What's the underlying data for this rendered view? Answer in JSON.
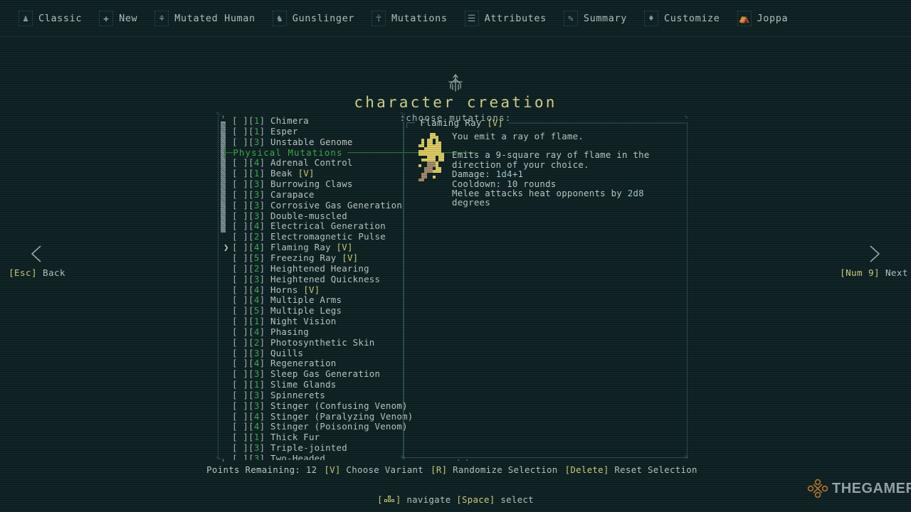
{
  "colors": {
    "background": "#0e2124",
    "title": "#d8d891",
    "cost": "#3fae4e",
    "header_green": "#3fae4e",
    "variant_yellow": "#d4d47e",
    "body_text": "#c2cec9",
    "value_cyan": "#a9cfd4",
    "watermark_logo": "#b5762e"
  },
  "topnav": {
    "items": [
      {
        "icon": "character-classic-icon",
        "label": "Classic"
      },
      {
        "icon": "plus-new-icon",
        "label": "New"
      },
      {
        "icon": "mutated-human-icon",
        "label": "Mutated Human"
      },
      {
        "icon": "gunslinger-icon",
        "label": "Gunslinger"
      },
      {
        "icon": "mutations-dna-icon",
        "label": "Mutations"
      },
      {
        "icon": "attributes-icon",
        "label": "Attributes"
      },
      {
        "icon": "summary-scroll-icon",
        "label": "Summary"
      },
      {
        "icon": "customize-brush-icon",
        "label": "Customize"
      },
      {
        "icon": "joppa-village-icon",
        "label": "Joppa"
      }
    ]
  },
  "title": {
    "crest_icon": "qud-crest-icon",
    "heading": "character creation",
    "subheading": ":choose mutations:"
  },
  "list": {
    "scroll_up_glyph": "↑",
    "scroll_down_glyph": "↓",
    "cursor_glyph": "❯",
    "checkbox_empty": "[ ]",
    "rows": [
      {
        "type": "mutation",
        "checkbox": "[ ]",
        "cost": "1",
        "name": "Chimera",
        "variant": ""
      },
      {
        "type": "mutation",
        "checkbox": "[ ]",
        "cost": "1",
        "name": "Esper",
        "variant": ""
      },
      {
        "type": "mutation",
        "checkbox": "[ ]",
        "cost": "3",
        "name": "Unstable Genome",
        "variant": ""
      },
      {
        "type": "header",
        "label": "Physical Mutations"
      },
      {
        "type": "mutation",
        "checkbox": "[ ]",
        "cost": "4",
        "name": "Adrenal Control",
        "variant": ""
      },
      {
        "type": "mutation",
        "checkbox": "[ ]",
        "cost": "1",
        "name": "Beak",
        "variant": "[V]"
      },
      {
        "type": "mutation",
        "checkbox": "[ ]",
        "cost": "3",
        "name": "Burrowing Claws",
        "variant": ""
      },
      {
        "type": "mutation",
        "checkbox": "[ ]",
        "cost": "3",
        "name": "Carapace",
        "variant": ""
      },
      {
        "type": "mutation",
        "checkbox": "[ ]",
        "cost": "3",
        "name": "Corrosive Gas Generation",
        "variant": ""
      },
      {
        "type": "mutation",
        "checkbox": "[ ]",
        "cost": "3",
        "name": "Double-muscled",
        "variant": ""
      },
      {
        "type": "mutation",
        "checkbox": "[ ]",
        "cost": "4",
        "name": "Electrical Generation",
        "variant": ""
      },
      {
        "type": "mutation",
        "checkbox": "[ ]",
        "cost": "2",
        "name": "Electromagnetic Pulse",
        "variant": ""
      },
      {
        "type": "mutation",
        "checkbox": "[ ]",
        "cost": "4",
        "name": "Flaming Ray",
        "variant": "[V]",
        "selected": true
      },
      {
        "type": "mutation",
        "checkbox": "[ ]",
        "cost": "5",
        "name": "Freezing Ray",
        "variant": "[V]"
      },
      {
        "type": "mutation",
        "checkbox": "[ ]",
        "cost": "2",
        "name": "Heightened Hearing",
        "variant": ""
      },
      {
        "type": "mutation",
        "checkbox": "[ ]",
        "cost": "3",
        "name": "Heightened Quickness",
        "variant": ""
      },
      {
        "type": "mutation",
        "checkbox": "[ ]",
        "cost": "4",
        "name": "Horns",
        "variant": "[V]"
      },
      {
        "type": "mutation",
        "checkbox": "[ ]",
        "cost": "4",
        "name": "Multiple Arms",
        "variant": ""
      },
      {
        "type": "mutation",
        "checkbox": "[ ]",
        "cost": "5",
        "name": "Multiple Legs",
        "variant": ""
      },
      {
        "type": "mutation",
        "checkbox": "[ ]",
        "cost": "1",
        "name": "Night Vision",
        "variant": ""
      },
      {
        "type": "mutation",
        "checkbox": "[ ]",
        "cost": "4",
        "name": "Phasing",
        "variant": ""
      },
      {
        "type": "mutation",
        "checkbox": "[ ]",
        "cost": "2",
        "name": "Photosynthetic Skin",
        "variant": ""
      },
      {
        "type": "mutation",
        "checkbox": "[ ]",
        "cost": "3",
        "name": "Quills",
        "variant": ""
      },
      {
        "type": "mutation",
        "checkbox": "[ ]",
        "cost": "4",
        "name": "Regeneration",
        "variant": ""
      },
      {
        "type": "mutation",
        "checkbox": "[ ]",
        "cost": "3",
        "name": "Sleep Gas Generation",
        "variant": ""
      },
      {
        "type": "mutation",
        "checkbox": "[ ]",
        "cost": "1",
        "name": "Slime Glands",
        "variant": ""
      },
      {
        "type": "mutation",
        "checkbox": "[ ]",
        "cost": "3",
        "name": "Spinnerets",
        "variant": ""
      },
      {
        "type": "mutation",
        "checkbox": "[ ]",
        "cost": "3",
        "name": "Stinger (Confusing Venom)",
        "variant": ""
      },
      {
        "type": "mutation",
        "checkbox": "[ ]",
        "cost": "4",
        "name": "Stinger (Paralyzing Venom)",
        "variant": ""
      },
      {
        "type": "mutation",
        "checkbox": "[ ]",
        "cost": "4",
        "name": "Stinger (Poisoning Venom)",
        "variant": ""
      },
      {
        "type": "mutation",
        "checkbox": "[ ]",
        "cost": "1",
        "name": "Thick Fur",
        "variant": ""
      },
      {
        "type": "mutation",
        "checkbox": "[ ]",
        "cost": "3",
        "name": "Triple-jointed",
        "variant": ""
      },
      {
        "type": "mutation",
        "checkbox": "[ ]",
        "cost": "3",
        "name": "Two-Headed",
        "variant": "",
        "clipped": true
      }
    ]
  },
  "detail": {
    "title": "Flaming Ray",
    "title_variant": "[V]",
    "sprite_icon": "flaming-ray-sprite",
    "summary": "You emit a ray of flame.",
    "description": "Emits a 9-square ray of flame in the direction of your choice.",
    "damage_label": "Damage: ",
    "damage_value": "1d4+1",
    "cooldown_label": "Cooldown: ",
    "cooldown_value": "10 rounds",
    "melee_prefix": "Melee attacks heat opponents by ",
    "melee_value": "2d8",
    "melee_suffix": " degrees"
  },
  "sidenav": {
    "back": {
      "chevron": "❮",
      "key": "[Esc]",
      "label": " Back"
    },
    "next": {
      "chevron": "❯",
      "key": "[Num 9]",
      "label": " Next"
    }
  },
  "status": {
    "points_label": "Points Remaining: ",
    "points_value": "12",
    "actions": [
      {
        "key": "[V]",
        "label": " Choose Variant"
      },
      {
        "key": "[R]",
        "label": " Randomize Selection"
      },
      {
        "key": "[Delete]",
        "label": " Reset Selection"
      }
    ]
  },
  "hint": {
    "nav_icon": "arrow-keys-icon",
    "nav_open": "[",
    "nav_close": "]",
    "nav_label": " navigate  ",
    "select_key": "[Space]",
    "select_label": " select"
  },
  "watermark": {
    "logo_icon": "thegamer-ornament-icon",
    "text": "THEGAMER"
  }
}
